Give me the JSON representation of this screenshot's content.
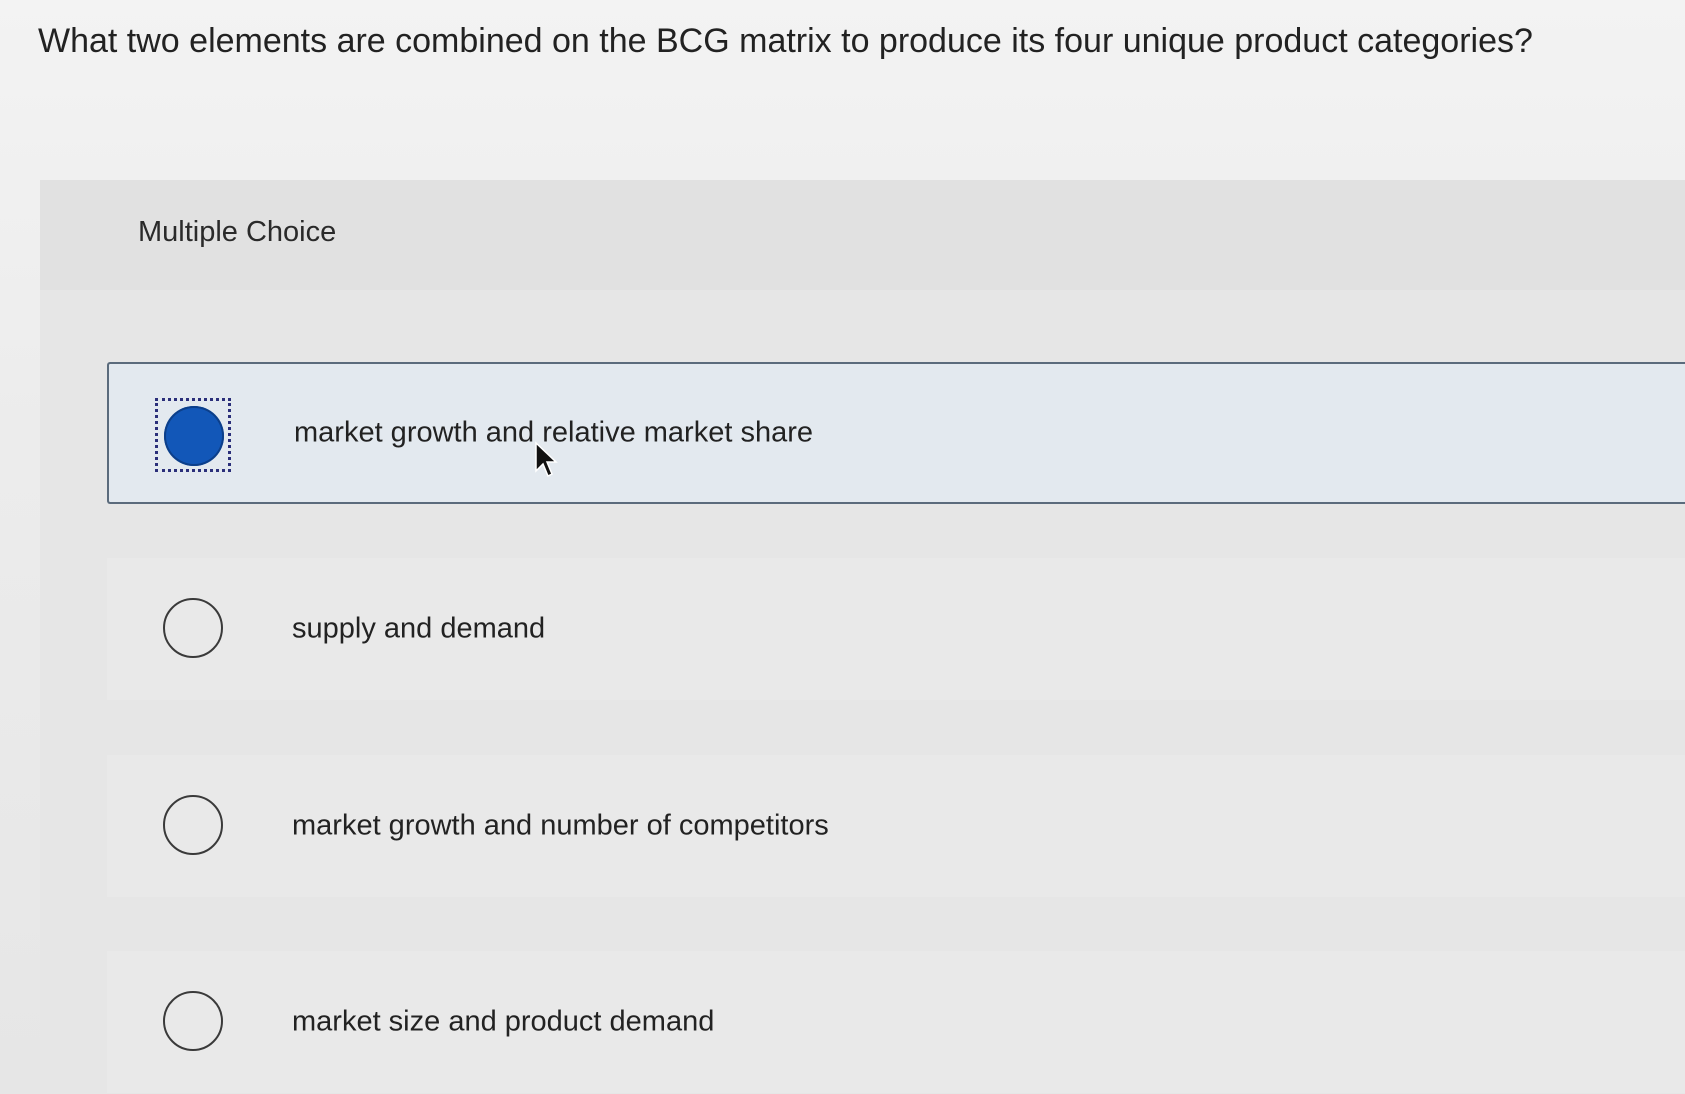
{
  "question": {
    "text": "What two elements are combined on the BCG matrix to produce its four unique product categories?"
  },
  "panel": {
    "label": "Multiple Choice"
  },
  "options": [
    {
      "text": "market growth and relative market share",
      "selected": true
    },
    {
      "text": "supply and demand",
      "selected": false
    },
    {
      "text": "market growth and number of competitors",
      "selected": false
    },
    {
      "text": "market size and product demand",
      "selected": false
    }
  ],
  "colors": {
    "selected_radio": "#1257b8",
    "selected_background": "#e3e9ef",
    "selected_border": "#5b6b7c",
    "focus_ring": "#2b2f7a"
  },
  "icons": {
    "cursor": "mouse-pointer-icon"
  }
}
